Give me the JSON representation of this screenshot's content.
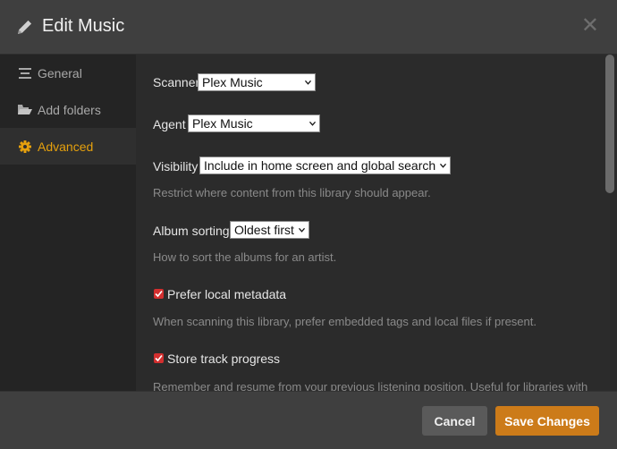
{
  "header": {
    "title": "Edit Music"
  },
  "sidebar": {
    "items": [
      {
        "label": "General",
        "icon": "list-icon"
      },
      {
        "label": "Add folders",
        "icon": "folder-open-icon"
      },
      {
        "label": "Advanced",
        "icon": "gear-icon"
      }
    ],
    "active": "Advanced"
  },
  "advanced": {
    "scanner": {
      "label": "Scanner",
      "value": "Plex Music"
    },
    "agent": {
      "label": "Agent",
      "value": "Plex Music"
    },
    "visibility": {
      "label": "Visibility",
      "value": "Include in home screen and global search",
      "help": "Restrict where content from this library should appear."
    },
    "album_sorting": {
      "label": "Album sorting",
      "value": "Oldest first",
      "help": "How to sort the albums for an artist."
    },
    "prefer_local_metadata": {
      "label": "Prefer local metadata",
      "checked": true,
      "help": "When scanning this library, prefer embedded tags and local files if present."
    },
    "store_track_progress": {
      "label": "Store track progress",
      "checked": true,
      "help": "Remember and resume from your previous listening position. Useful for libraries with"
    }
  },
  "footer": {
    "cancel_label": "Cancel",
    "save_label": "Save Changes"
  },
  "colors": {
    "accent": "#e5a00d",
    "save_button": "#cc7b19",
    "checkbox": "#d32f2f"
  }
}
